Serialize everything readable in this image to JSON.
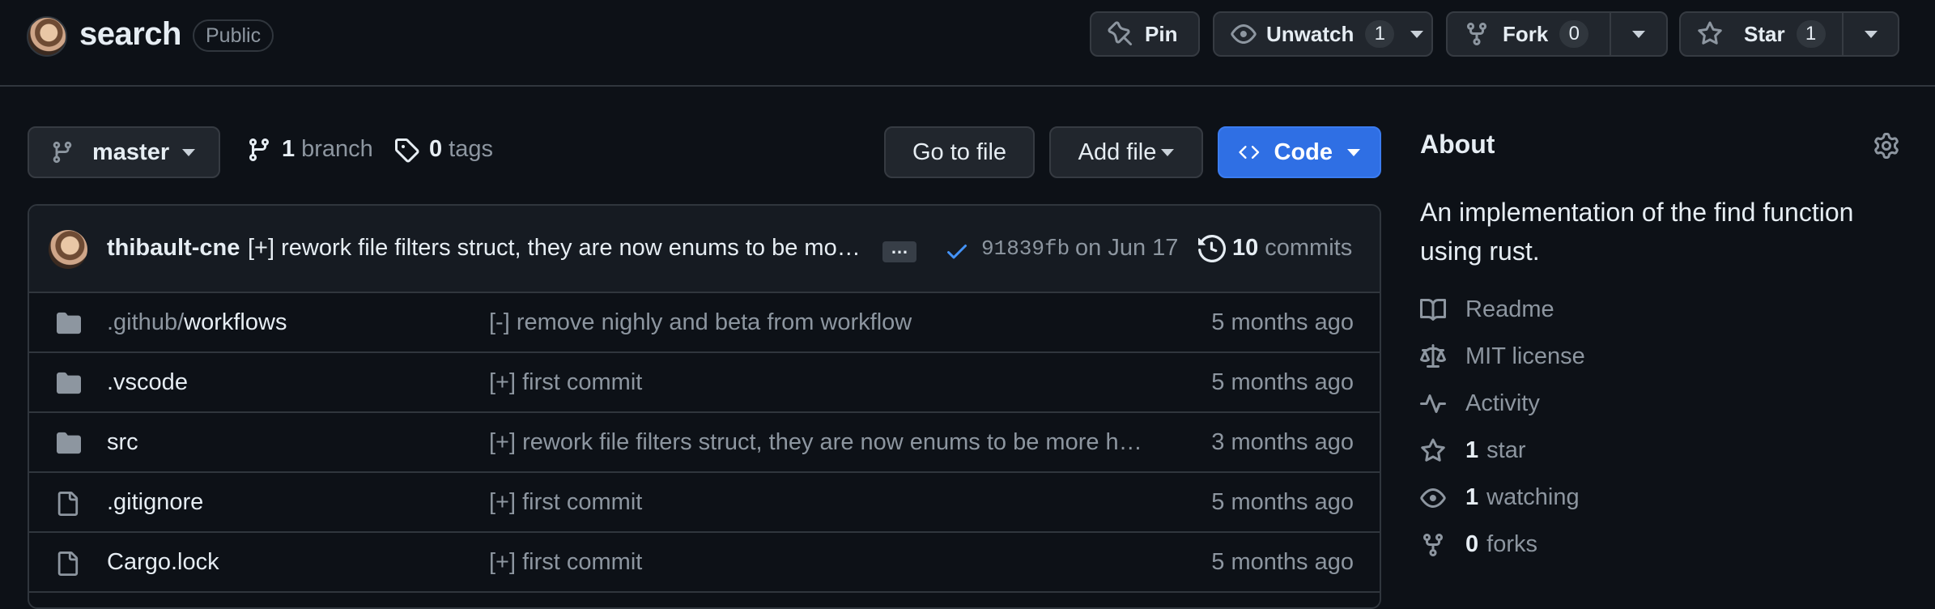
{
  "repo": {
    "name": "search",
    "visibility": "Public"
  },
  "actions": {
    "pin_label": "Pin",
    "unwatch_label": "Unwatch",
    "unwatch_count": "1",
    "fork_label": "Fork",
    "fork_count": "0",
    "star_label": "Star",
    "star_count": "1"
  },
  "toolbar": {
    "branch_name": "master",
    "branch_count": "1",
    "branch_label": "branch",
    "tag_count": "0",
    "tag_label": "tags",
    "go_to_file": "Go to file",
    "add_file": "Add file",
    "code": "Code"
  },
  "latest_commit": {
    "author": "thibault-cne",
    "message": "[+] rework file filters struct, they are now enums to be mo…",
    "ellipsis": "…",
    "sha": "91839fb",
    "date": "on Jun 17",
    "commit_count": "10",
    "commit_label": "commits"
  },
  "files": [
    {
      "type": "folder",
      "prefix": ".github/",
      "name": "workflows",
      "message": "[-] remove nighly and beta from workflow",
      "age": "5 months ago"
    },
    {
      "type": "folder",
      "prefix": "",
      "name": ".vscode",
      "message": "[+] first commit",
      "age": "5 months ago"
    },
    {
      "type": "folder",
      "prefix": "",
      "name": "src",
      "message": "[+] rework file filters struct, they are now enums to be more ha…",
      "age": "3 months ago"
    },
    {
      "type": "file",
      "prefix": "",
      "name": ".gitignore",
      "message": "[+] first commit",
      "age": "5 months ago"
    },
    {
      "type": "file",
      "prefix": "",
      "name": "Cargo.lock",
      "message": "[+] first commit",
      "age": "5 months ago"
    }
  ],
  "about": {
    "title": "About",
    "description": "An implementation of the find function using rust.",
    "readme": "Readme",
    "license": "MIT license",
    "activity": "Activity",
    "stars_count": "1",
    "stars_label": "star",
    "watching_count": "1",
    "watching_label": "watching",
    "forks_count": "0",
    "forks_label": "forks"
  },
  "colors": {
    "background": "#0d1117",
    "border": "#30363d",
    "button": "#21262d",
    "accent": "#2f6fe4",
    "muted_text": "#8d96a0",
    "text": "#e6edf3"
  }
}
